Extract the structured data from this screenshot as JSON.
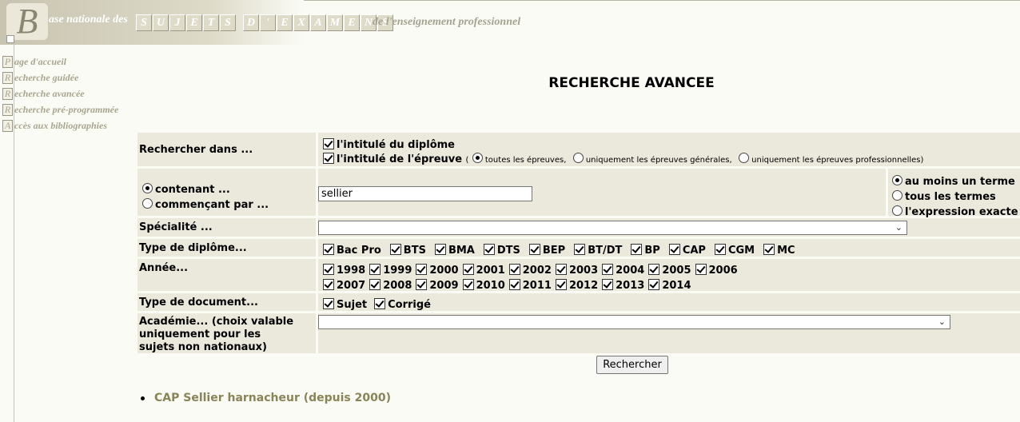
{
  "banner": {
    "logo_letter": "B",
    "text1": "ase nationale des",
    "word1": [
      "S",
      "U",
      "J",
      "E",
      "T",
      "S"
    ],
    "word2": [
      "D",
      "'",
      "E",
      "X",
      "A",
      "M",
      "E",
      "N",
      "S"
    ],
    "text2": "de l'enseignement professionnel"
  },
  "nav": [
    {
      "initial": "P",
      "rest": "age d'accueil"
    },
    {
      "initial": "R",
      "rest": "echerche guidée"
    },
    {
      "initial": "R",
      "rest": "echerche avancée"
    },
    {
      "initial": "R",
      "rest": "echerche pré-programmée"
    },
    {
      "initial": "A",
      "rest": "ccès aux bibliographies"
    }
  ],
  "page_title": "RECHERCHE AVANCEE",
  "form": {
    "search_in": {
      "label": "Rechercher dans ...",
      "diplome_label": "l'intitulé du diplôme",
      "epreuve_label": "l'intitulé de l'épreuve",
      "paren_open": "(",
      "paren_close": ")",
      "opt_all": "toutes les épreuves,",
      "opt_general": "uniquement les épreuves générales,",
      "opt_pro": "uniquement les épreuves professionnelles"
    },
    "mode": {
      "contains": "contenant ...",
      "starts": "commençant par ...",
      "value": "sellier",
      "at_least_one": "au moins un terme",
      "all_terms": "tous les termes",
      "exact": "l'expression exacte"
    },
    "specialite": {
      "label": "Spécialité ...",
      "value": ""
    },
    "diplome_type": {
      "label": "Type de diplôme...",
      "options": [
        "Bac Pro",
        "BTS",
        "BMA",
        "DTS",
        "BEP",
        "BT/DT",
        "BP",
        "CAP",
        "CGM",
        "MC"
      ]
    },
    "annee": {
      "label": "Année...",
      "row1": [
        "1998",
        "1999",
        "2000",
        "2001",
        "2002",
        "2003",
        "2004",
        "2005",
        "2006"
      ],
      "row2": [
        "2007",
        "2008",
        "2009",
        "2010",
        "2011",
        "2012",
        "2013",
        "2014"
      ]
    },
    "doc_type": {
      "label": "Type de document...",
      "options": [
        "Sujet",
        "Corrigé"
      ]
    },
    "academie": {
      "label_l1": "Académie... (choix valable",
      "label_l2": "uniquement pour les",
      "label_l3": "sujets non nationaux)",
      "value": ""
    },
    "submit": "Rechercher"
  },
  "results": [
    "CAP Sellier harnacheur (depuis 2000)"
  ]
}
